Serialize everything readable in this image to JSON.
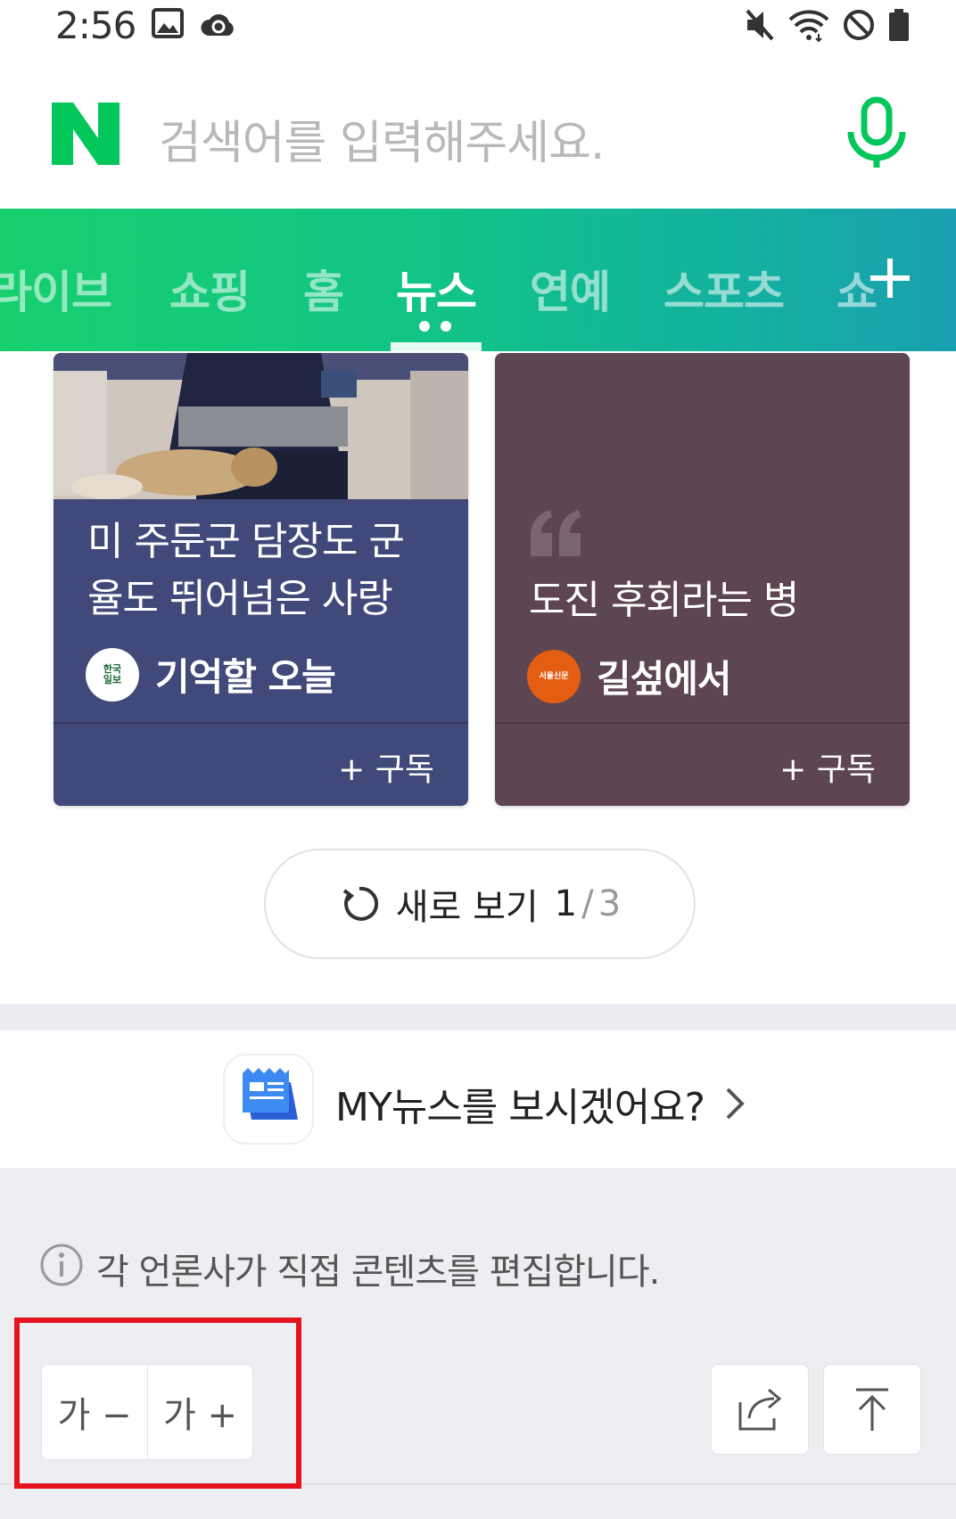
{
  "status_bar": {
    "time": "2:56"
  },
  "search": {
    "placeholder": "검색어를 입력해주세요.",
    "logo_letter": "N",
    "brand_color": "#03c75a"
  },
  "tabs": [
    {
      "label": "라이브",
      "active": false
    },
    {
      "label": "쇼핑",
      "active": false
    },
    {
      "label": "홈",
      "active": false
    },
    {
      "label": "뉴스",
      "active": true
    },
    {
      "label": "연예",
      "active": false
    },
    {
      "label": "스포츠",
      "active": false
    },
    {
      "label": "쇼",
      "active": false
    }
  ],
  "cards": [
    {
      "title_line1": "미 주둔군 담장도 군",
      "title_line2": "율도 뛰어넘은 사랑",
      "source_logo": "한국\n일보",
      "source_name": "기억할 오늘",
      "subscribe_label": "+ 구독",
      "bg_color": "#40497a"
    },
    {
      "title_line1": "도진 후회라는 병",
      "source_logo": "서울신문",
      "source_name": "길섶에서",
      "subscribe_label": "+ 구독",
      "bg_color": "#5d4552"
    }
  ],
  "refresh": {
    "label": "새로 보기",
    "page": "1",
    "separator": "/",
    "total": "3"
  },
  "mynews": {
    "text": "MY뉴스를 보시겠어요?"
  },
  "footer": {
    "info_text": "각 언론사가 직접 콘텐츠를 편집합니다.",
    "font_decrease_label": "가 −",
    "font_increase_label": "가 +"
  },
  "highlight_color": "#e3141e"
}
